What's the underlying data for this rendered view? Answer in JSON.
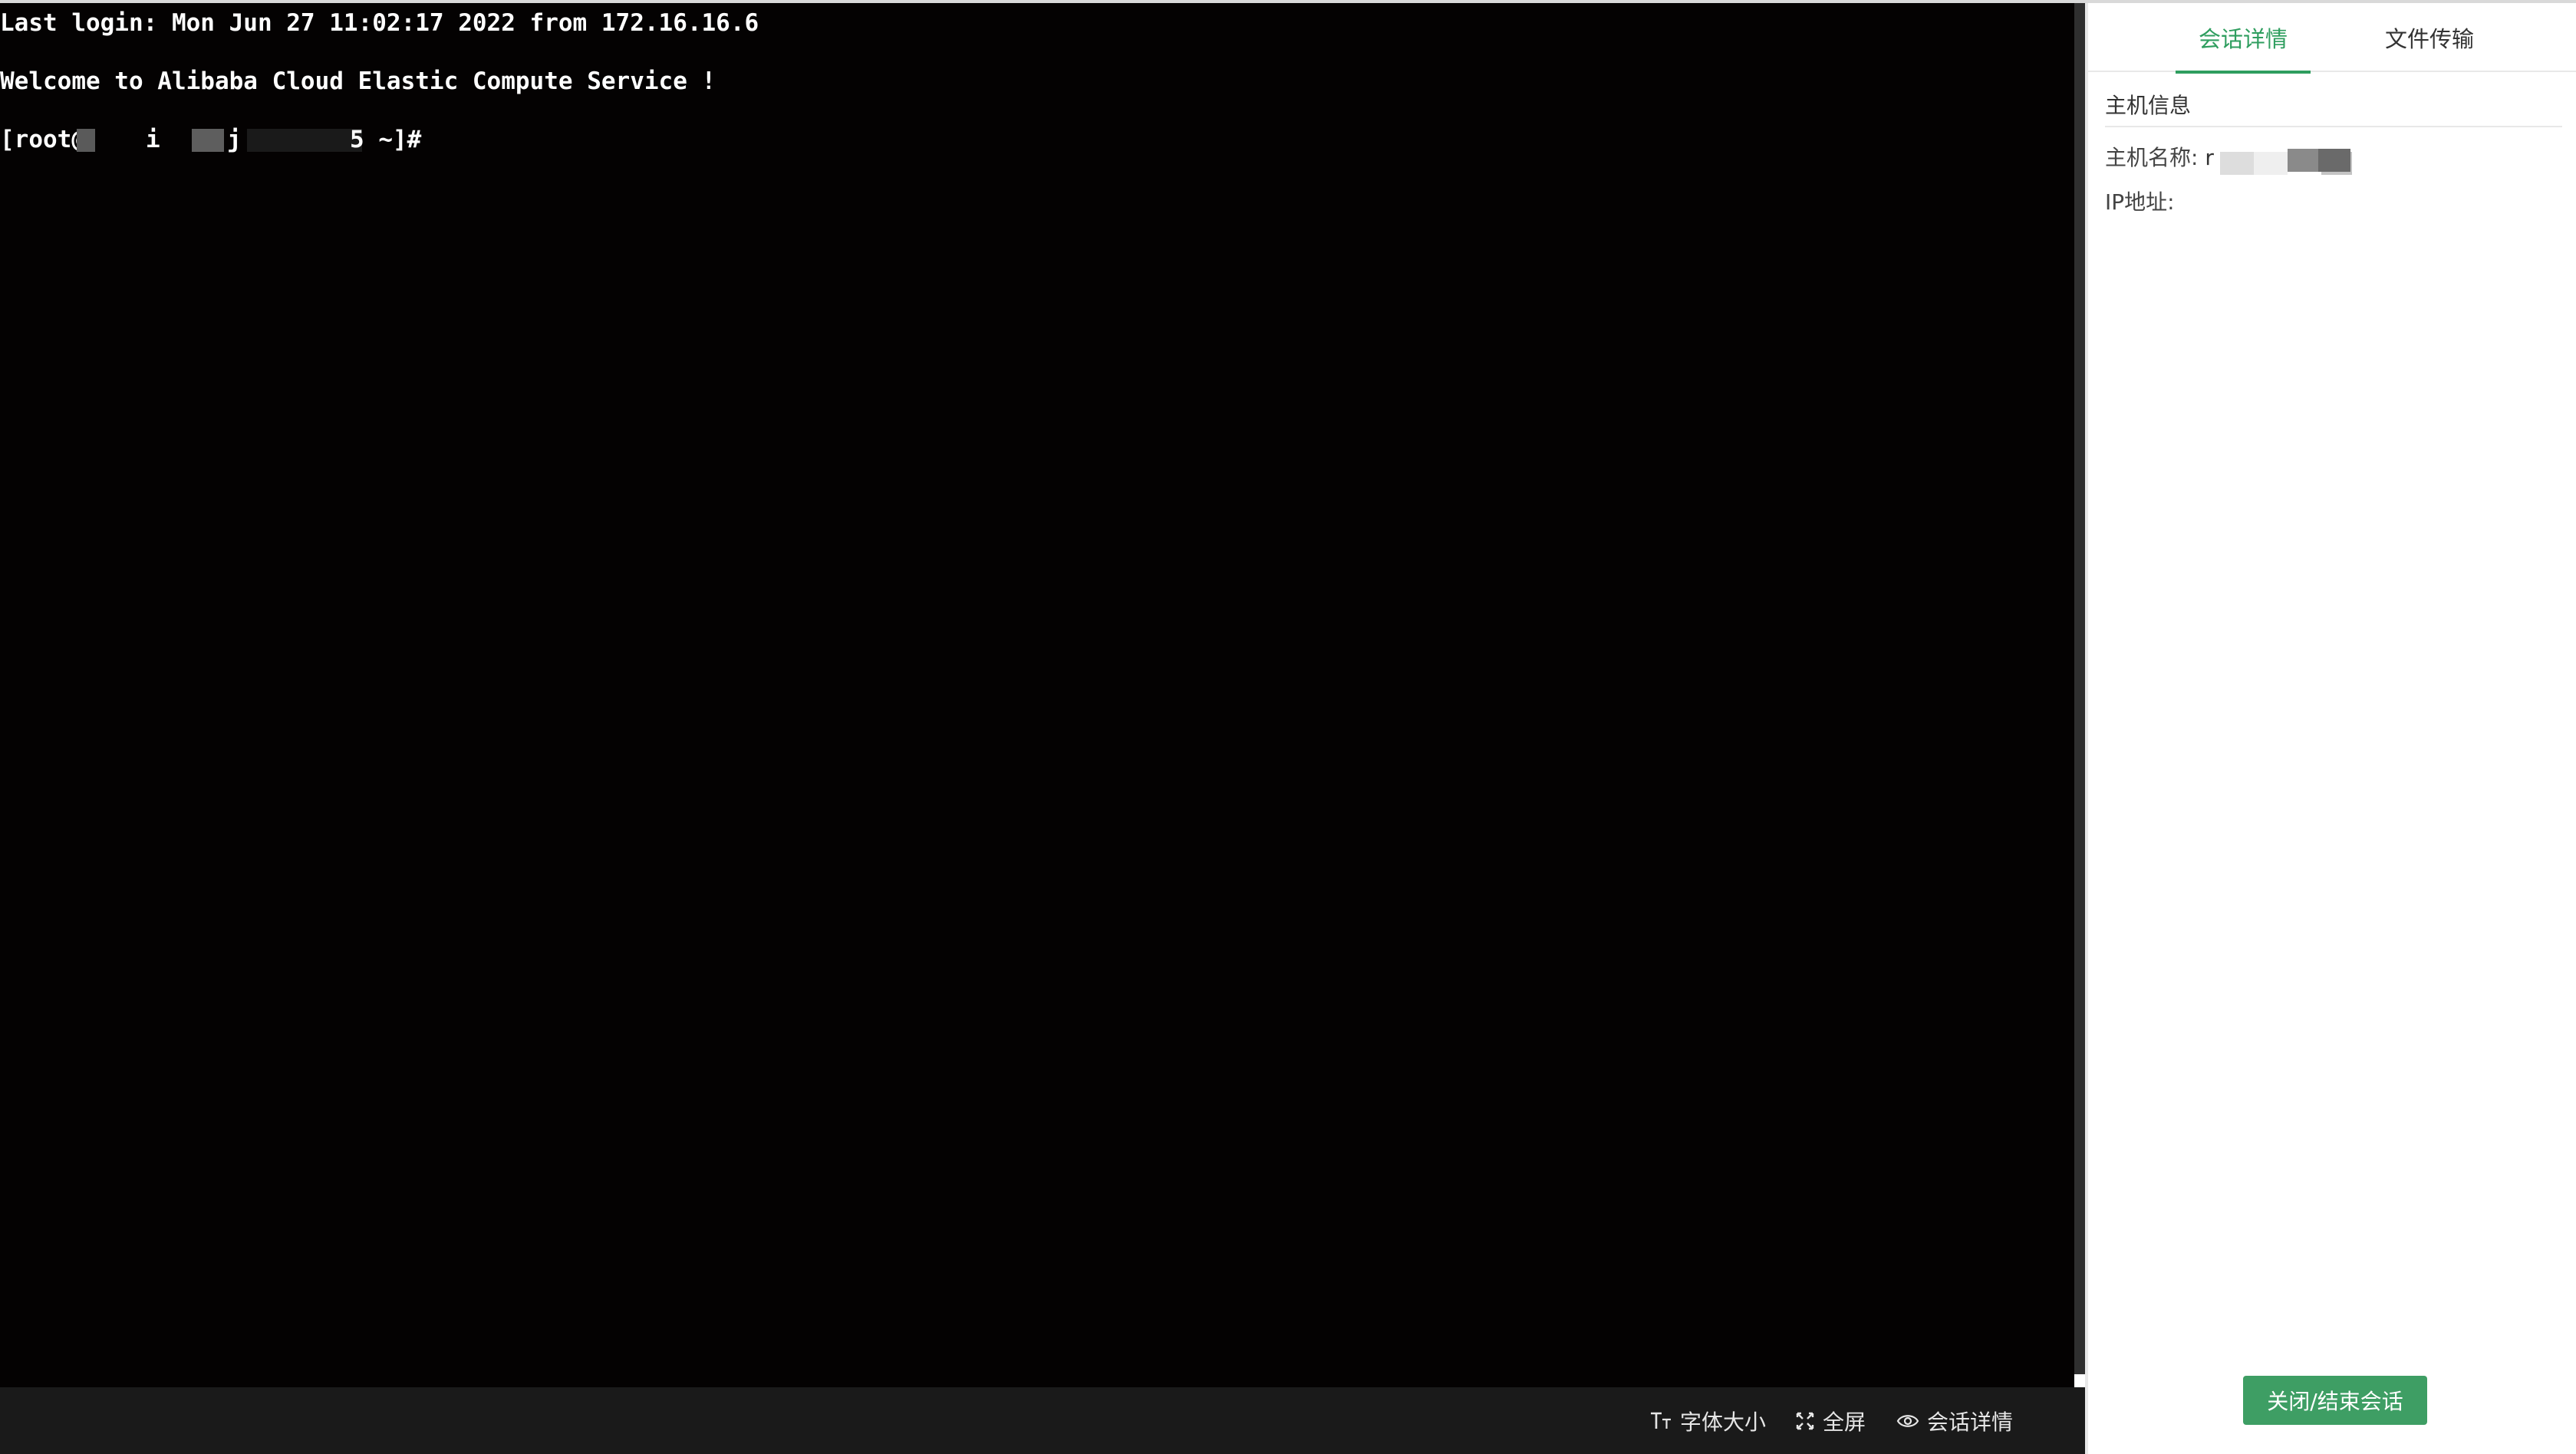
{
  "terminal": {
    "line1": "Last login: Mon Jun 27 11:02:17 2022 from 172.16.16.6",
    "line2": "Welcome to Alibaba Cloud Elastic Compute Service !",
    "prompt_start": "[root@",
    "prompt_mid_a": "i",
    "prompt_mid_b": "j",
    "prompt_mid_c": "5 ~]#"
  },
  "toolbar": {
    "font_size_label": "字体大小",
    "fullscreen_label": "全屏",
    "session_details_label": "会话详情"
  },
  "panel": {
    "tabs": [
      {
        "label": "会话详情",
        "active": true
      },
      {
        "label": "文件传输",
        "active": false
      }
    ],
    "section_title": "主机信息",
    "host_name_label": "主机名称:",
    "host_name_value": "r",
    "ip_label": "IP地址:",
    "end_session_label": "关闭/结束会话"
  },
  "colors": {
    "accent": "#2f9e5f",
    "button": "#3e9e64",
    "terminal_bg": "#040202",
    "toolbar_bg": "#1a1a1a"
  }
}
